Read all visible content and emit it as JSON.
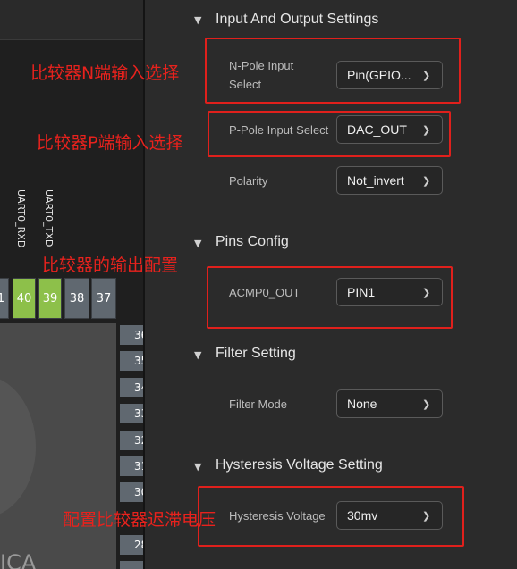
{
  "left": {
    "vertical_labels": [
      "UART0_RXD",
      "UART0_TXD"
    ],
    "pins_bottom": [
      {
        "label": "1",
        "highlight": false
      },
      {
        "label": "40",
        "highlight": true
      },
      {
        "label": "39",
        "highlight": true
      },
      {
        "label": "38",
        "highlight": false
      },
      {
        "label": "37",
        "highlight": false
      }
    ],
    "pins_right": [
      "36",
      "35",
      "34",
      "33",
      "32",
      "31",
      "30",
      "29",
      "28"
    ],
    "chip_text": "ICA"
  },
  "sections": {
    "io": {
      "title": "Input And Output Settings"
    },
    "pins": {
      "title": "Pins Config"
    },
    "filter": {
      "title": "Filter Setting"
    },
    "hyst": {
      "title": "Hysteresis Voltage Setting"
    }
  },
  "fields": {
    "npole": {
      "label_line1": "N-Pole Input",
      "label_line2": "Select",
      "value": "Pin(GPIO..."
    },
    "ppole": {
      "label": "P-Pole Input Select",
      "value": "DAC_OUT"
    },
    "polarity": {
      "label": "Polarity",
      "value": "Not_invert"
    },
    "acmp": {
      "label": "ACMP0_OUT",
      "value": "PIN1"
    },
    "filter_mode": {
      "label": "Filter Mode",
      "value": "None"
    },
    "hyst_voltage": {
      "label": "Hysteresis Voltage",
      "value": "30mv"
    }
  },
  "annotations": {
    "n_select": "比较器N端输入选择",
    "p_select": "比较器P端输入选择",
    "output": "比较器的输出配置",
    "hysteresis": "配置比较器迟滞电压"
  },
  "colors": {
    "annotation": "#e8221d",
    "pin_green": "#8dc04a",
    "pin_gray": "#606870"
  }
}
